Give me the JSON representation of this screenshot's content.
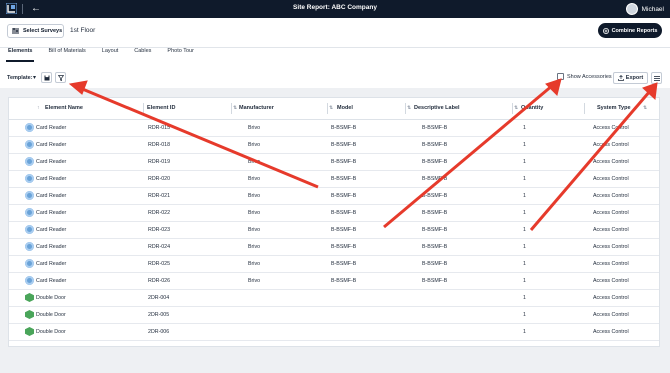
{
  "topbar": {
    "title": "Site Report: ABC Company",
    "user_name": "Michael"
  },
  "header": {
    "select_surveys_label": "Select Surveys",
    "floor": "1st Floor",
    "combine_label": "Combine Reports"
  },
  "tabs": [
    {
      "label": "Elements",
      "active": true
    },
    {
      "label": "Bill of Materials",
      "active": false
    },
    {
      "label": "Layout",
      "active": false
    },
    {
      "label": "Cables",
      "active": false
    },
    {
      "label": "Photo Tour",
      "active": false
    }
  ],
  "toolbar": {
    "template_label": "Template:",
    "show_accessories_label": "Show Accessories",
    "export_label": "Export"
  },
  "table": {
    "columns": [
      "Element Name",
      "Element ID",
      "Manufacturer",
      "Model",
      "Descriptive Label",
      "Quantity",
      "System Type"
    ],
    "rows": [
      {
        "name": "Card Reader",
        "id": "RDR-015",
        "manufacturer": "Brivo",
        "model": "B-BSMF-B",
        "label": "B-BSMF-B",
        "qty": "1",
        "system": "Access Control",
        "icon": "card-reader-icon"
      },
      {
        "name": "Card Reader",
        "id": "RDR-018",
        "manufacturer": "Brivo",
        "model": "B-BSMF-B",
        "label": "B-BSMF-B",
        "qty": "1",
        "system": "Access Control",
        "icon": "card-reader-icon"
      },
      {
        "name": "Card Reader",
        "id": "RDR-019",
        "manufacturer": "Brivo",
        "model": "B-BSMF-B",
        "label": "B-BSMF-B",
        "qty": "1",
        "system": "Access Control",
        "icon": "card-reader-icon"
      },
      {
        "name": "Card Reader",
        "id": "RDR-020",
        "manufacturer": "Brivo",
        "model": "B-BSMF-B",
        "label": "B-BSMF-B",
        "qty": "1",
        "system": "Access Control",
        "icon": "card-reader-icon"
      },
      {
        "name": "Card Reader",
        "id": "RDR-021",
        "manufacturer": "Brivo",
        "model": "B-BSMF-B",
        "label": "B-BSMF-B",
        "qty": "1",
        "system": "Access Control",
        "icon": "card-reader-icon"
      },
      {
        "name": "Card Reader",
        "id": "RDR-022",
        "manufacturer": "Brivo",
        "model": "B-BSMF-B",
        "label": "B-BSMF-B",
        "qty": "1",
        "system": "Access Control",
        "icon": "card-reader-icon"
      },
      {
        "name": "Card Reader",
        "id": "RDR-023",
        "manufacturer": "Brivo",
        "model": "B-BSMF-B",
        "label": "B-BSMF-B",
        "qty": "1",
        "system": "Access Control",
        "icon": "card-reader-icon"
      },
      {
        "name": "Card Reader",
        "id": "RDR-024",
        "manufacturer": "Brivo",
        "model": "B-BSMF-B",
        "label": "B-BSMF-B",
        "qty": "1",
        "system": "Access Control",
        "icon": "card-reader-icon"
      },
      {
        "name": "Card Reader",
        "id": "RDR-025",
        "manufacturer": "Brivo",
        "model": "B-BSMF-B",
        "label": "B-BSMF-B",
        "qty": "1",
        "system": "Access Control",
        "icon": "card-reader-icon"
      },
      {
        "name": "Card Reader",
        "id": "RDR-026",
        "manufacturer": "Brivo",
        "model": "B-BSMF-B",
        "label": "B-BSMF-B",
        "qty": "1",
        "system": "Access Control",
        "icon": "card-reader-icon"
      },
      {
        "name": "Double Door",
        "id": "2DR-004",
        "manufacturer": "",
        "model": "",
        "label": "",
        "qty": "1",
        "system": "Access Control",
        "icon": "door-icon"
      },
      {
        "name": "Double Door",
        "id": "2DR-005",
        "manufacturer": "",
        "model": "",
        "label": "",
        "qty": "1",
        "system": "Access Control",
        "icon": "door-icon"
      },
      {
        "name": "Double Door",
        "id": "2DR-006",
        "manufacturer": "",
        "model": "",
        "label": "",
        "qty": "1",
        "system": "Access Control",
        "icon": "door-icon"
      }
    ]
  },
  "colors": {
    "navy": "#0f1a2b",
    "annotation_red": "#e63a2b",
    "card_reader_icon": "#6aa3d8",
    "door_icon": "#4aa55a"
  }
}
